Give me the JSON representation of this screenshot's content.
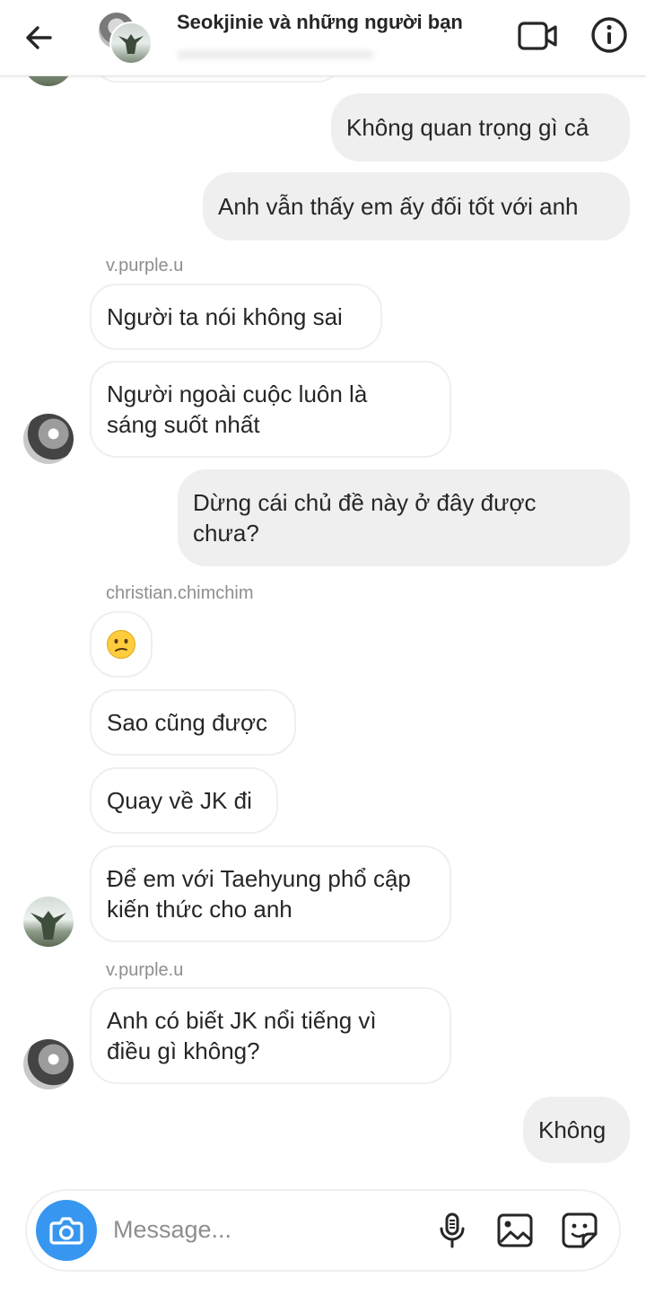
{
  "header": {
    "title": "Seokjinie và những người bạn"
  },
  "messages": {
    "m1": "Không quan trọng gì cả",
    "m2": "Anh vẫn thấy em ấy đối tốt với anh",
    "sender1": "v.purple.u",
    "m3": "Người ta nói không sai",
    "m4_l1": "Người ngoài cuộc luôn là",
    "m4_l2": "sáng suốt nhất",
    "m5_l1": "Dừng cái chủ đề này ở đây được",
    "m5_l2": "chưa?",
    "sender2": "christian.chimchim",
    "m6": "🙁",
    "m7": "Sao cũng được",
    "m8": "Quay về JK đi",
    "m9_l1": "Để em với Taehyung phổ cập",
    "m9_l2": "kiến thức cho anh",
    "sender3": "v.purple.u",
    "m10_l1": "Anh có biết JK nổi tiếng vì",
    "m10_l2": "điều gì không?",
    "m11": "Không"
  },
  "composer": {
    "placeholder": "Message..."
  },
  "icons": {
    "back": "arrow-left-icon",
    "video": "video-call-icon",
    "info": "info-icon",
    "camera": "camera-icon",
    "mic": "microphone-icon",
    "gallery": "image-icon",
    "sticker": "sticker-icon"
  },
  "colors": {
    "accent": "#3797f0",
    "outgoing_bubble": "#efefef",
    "secondary_text": "#8e8e8e"
  }
}
